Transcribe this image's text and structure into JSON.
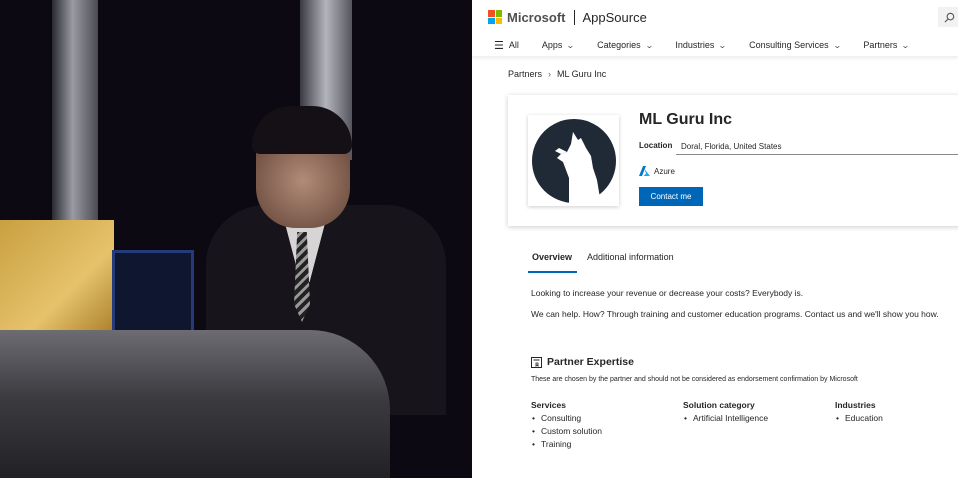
{
  "photo": {
    "description_icon": "person-presenting-photo"
  },
  "header": {
    "brand": "Microsoft",
    "product": "AppSource",
    "search_icon": "search-icon"
  },
  "nav": {
    "all_label": "All",
    "items": [
      {
        "label": "Apps"
      },
      {
        "label": "Categories"
      },
      {
        "label": "Industries"
      },
      {
        "label": "Consulting Services"
      },
      {
        "label": "Partners"
      }
    ]
  },
  "breadcrumb": {
    "root": "Partners",
    "current": "ML Guru Inc"
  },
  "partner": {
    "name": "ML Guru Inc",
    "location_label": "Location",
    "location_value": "Doral, Florida, United States",
    "platform": "Azure",
    "contact_label": "Contact me"
  },
  "tabs": [
    {
      "label": "Overview",
      "active": true
    },
    {
      "label": "Additional information",
      "active": false
    }
  ],
  "overview": {
    "line1": "Looking to increase your revenue or decrease your costs? Everybody is.",
    "line2": "We can help. How? Through training and customer education programs. Contact us and we'll show you how."
  },
  "expertise": {
    "title": "Partner Expertise",
    "subtitle": "These are chosen by the partner and should not be considered as endorsement confirmation by Microsoft",
    "services_title": "Services",
    "services": [
      "Consulting",
      "Custom solution",
      "Training"
    ],
    "solution_title": "Solution category",
    "solutions": [
      "Artificial Intelligence"
    ],
    "industries_title": "Industries",
    "industries": [
      "Education"
    ]
  },
  "colors": {
    "accent": "#0067b8",
    "logo_dark": "#1f2a36"
  }
}
